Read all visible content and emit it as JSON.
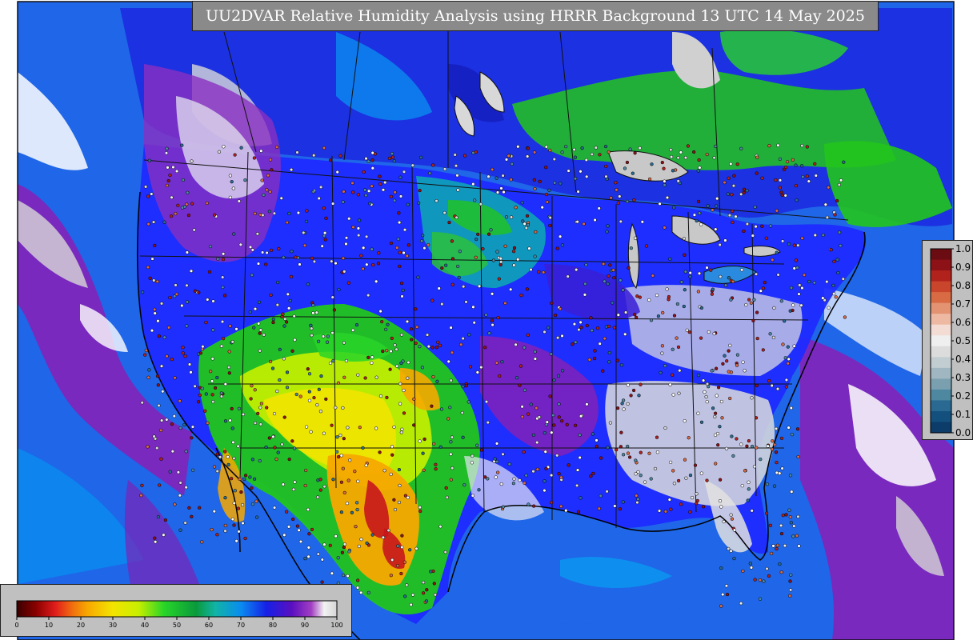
{
  "title": "UU2DVAR Relative Humidity Analysis using HRRR Background 13 UTC 14 May 2025",
  "rh_colorbar": {
    "ticks": [
      "0",
      "10",
      "20",
      "30",
      "40",
      "50",
      "60",
      "70",
      "80",
      "90",
      "100"
    ]
  },
  "innovation_colorbar": {
    "ticks": [
      "1.0",
      "0.9",
      "0.8",
      "0.7",
      "0.6",
      "0.5",
      "0.4",
      "0.3",
      "0.2",
      "0.1",
      "0.0"
    ]
  },
  "colors": {
    "ocean_blue": "#1f66e8",
    "purple": "#8a1fb5",
    "land_gray": "#c8c8c8",
    "green": "#22c51c",
    "yellow": "#f2e400",
    "orange": "#f7a800",
    "red": "#c8161c"
  }
}
